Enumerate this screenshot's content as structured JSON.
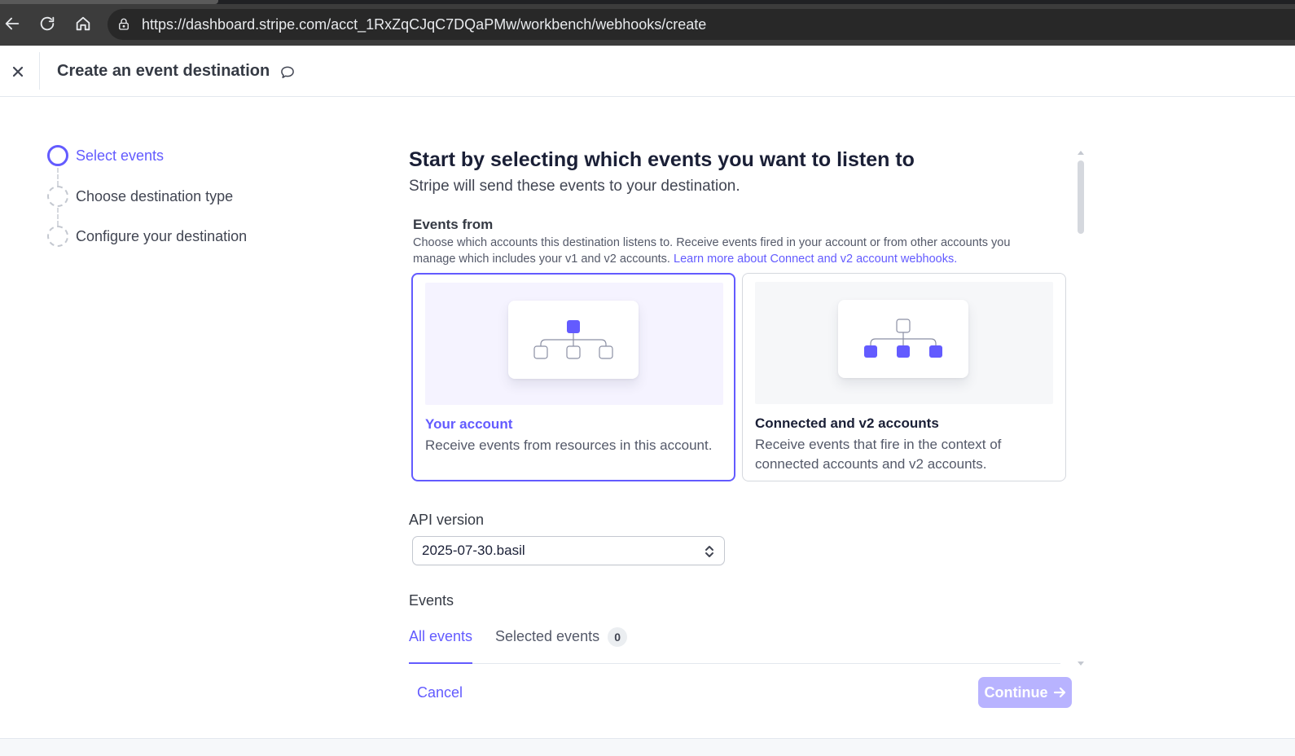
{
  "browser": {
    "url": "https://dashboard.stripe.com/acct_1RxZqCJqC7DQaPMw/workbench/webhooks/create",
    "icons": {
      "back": "arrow-left-icon",
      "reload": "reload-icon",
      "home": "home-icon",
      "site_info": "lock-icon"
    }
  },
  "header": {
    "title": "Create an event destination",
    "icons": {
      "close": "close-icon",
      "feedback": "speech-bubble-icon"
    }
  },
  "stepper": {
    "steps": [
      {
        "label": "Select events",
        "state": "active"
      },
      {
        "label": "Choose destination type",
        "state": "pending"
      },
      {
        "label": "Configure your destination",
        "state": "pending"
      }
    ]
  },
  "main": {
    "title": "Start by selecting which events you want to listen to",
    "subtitle": "Stripe will send these events to your destination.",
    "events_from": {
      "label": "Events from",
      "description": "Choose which accounts this destination listens to. Receive events fired in your account or from other accounts you manage which includes your v1 and v2 accounts.",
      "link_text": "Learn more about Connect and v2 account webhooks.",
      "options": [
        {
          "title": "Your account",
          "description": "Receive events from resources in this account.",
          "selected": true
        },
        {
          "title": "Connected and v2 accounts",
          "description": "Receive events that fire in the context of connected accounts and v2 accounts.",
          "selected": false
        }
      ]
    },
    "api_version": {
      "label": "API version",
      "value": "2025-07-30.basil"
    },
    "events": {
      "label": "Events",
      "tabs": [
        {
          "label": "All events",
          "active": true
        },
        {
          "label": "Selected events",
          "active": false,
          "count": "0"
        }
      ]
    }
  },
  "footer": {
    "cancel_label": "Cancel",
    "continue_label": "Continue",
    "continue_enabled": false
  },
  "colors": {
    "accent": "#635bff",
    "accent_disabled": "#b8b3ff",
    "text_primary": "#1a1f36",
    "text_secondary": "#545969",
    "border": "#d5d8de"
  }
}
